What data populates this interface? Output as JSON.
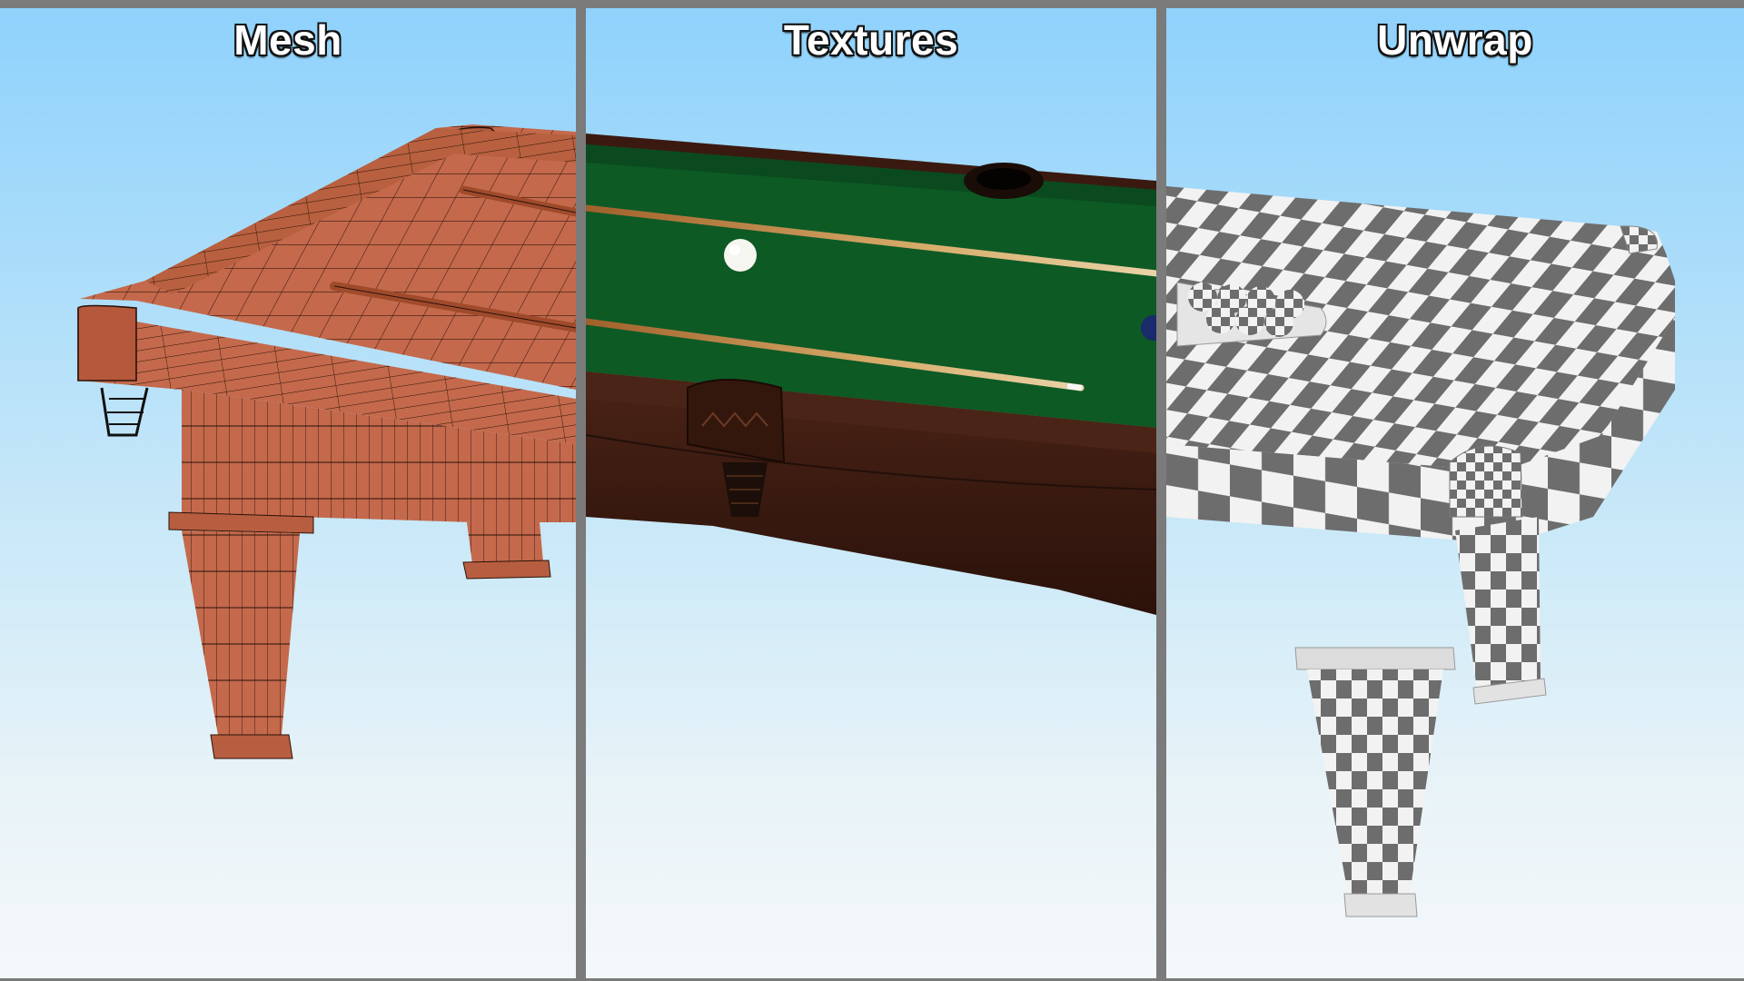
{
  "panels": [
    {
      "id": "mesh",
      "title": "Mesh",
      "render": "wireframe"
    },
    {
      "id": "textures",
      "title": "Textures",
      "render": "textured"
    },
    {
      "id": "unwrap",
      "title": "Unwrap",
      "render": "checker"
    }
  ],
  "colors": {
    "sky_top": "#8fd2fc",
    "sky_bottom": "#f4f8fa",
    "divider": "#7b7b7b",
    "mesh_wood": "#c4694c",
    "mesh_wire": "#2a1208",
    "felt": "#0d5a25",
    "rail_wood": "#3a1a10",
    "checker_dark": "#6d6d6d",
    "checker_light": "#f2f2f2"
  }
}
